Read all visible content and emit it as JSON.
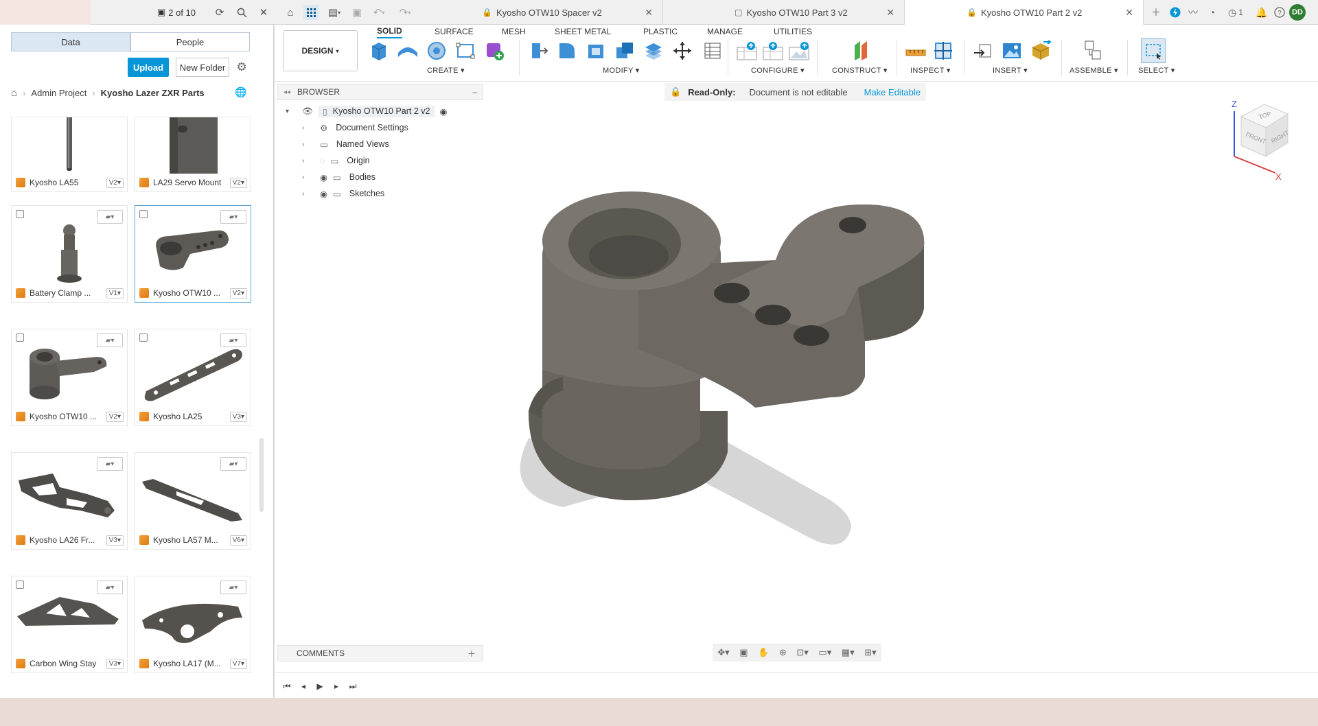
{
  "topbar": {
    "doc_counter": "2 of 10",
    "tabs": [
      {
        "label": "Kyosho OTW10 Spacer v2",
        "locked": true
      },
      {
        "label": "Kyosho OTW10 Part 3 v2",
        "locked": false
      },
      {
        "label": "Kyosho OTW10 Part 2 v2",
        "locked": true,
        "active": true
      }
    ],
    "job_count": "1",
    "user_initials": "DD"
  },
  "data_panel": {
    "tab_data": "Data",
    "tab_people": "People",
    "upload_label": "Upload",
    "new_folder_label": "New Folder",
    "breadcrumb": [
      "Admin Project",
      "Kyosho Lazer ZXR Parts"
    ],
    "items": [
      {
        "name": "Kyosho LA55",
        "version": "V2"
      },
      {
        "name": "LA29 Servo Mount",
        "version": "V2"
      },
      {
        "name": "Battery Clamp ...",
        "version": "V1"
      },
      {
        "name": "Kyosho OTW10 ...",
        "version": "V2"
      },
      {
        "name": "Kyosho OTW10 ...",
        "version": "V2"
      },
      {
        "name": "Kyosho LA25",
        "version": "V3"
      },
      {
        "name": "Kyosho LA26 Fr...",
        "version": "V3"
      },
      {
        "name": "Kyosho LA57 M...",
        "version": "V6"
      },
      {
        "name": "Carbon Wing Stay",
        "version": "V3"
      },
      {
        "name": "Kyosho LA17 (M...",
        "version": "V7"
      }
    ]
  },
  "toolbar": {
    "workspace": "DESIGN",
    "tabs": [
      "SOLID",
      "SURFACE",
      "MESH",
      "SHEET METAL",
      "PLASTIC",
      "MANAGE",
      "UTILITIES"
    ],
    "groups": [
      "CREATE",
      "MODIFY",
      "CONFIGURE",
      "CONSTRUCT",
      "INSPECT",
      "INSERT",
      "ASSEMBLE",
      "SELECT"
    ]
  },
  "browser": {
    "header": "BROWSER",
    "root": "Kyosho OTW10 Part 2 v2",
    "nodes": [
      "Document Settings",
      "Named Views",
      "Origin",
      "Bodies",
      "Sketches"
    ]
  },
  "readonly_banner": {
    "label": "Read-Only:",
    "message": "Document is not editable",
    "action": "Make Editable"
  },
  "viewcube": {
    "top": "TOP",
    "front": "FRONT",
    "right": "RIGHT",
    "z": "Z",
    "x": "X"
  },
  "comments": {
    "label": "COMMENTS"
  },
  "colors": {
    "accent": "#0696d7",
    "part": "#6a665f",
    "avatar": "#2e7d32"
  }
}
